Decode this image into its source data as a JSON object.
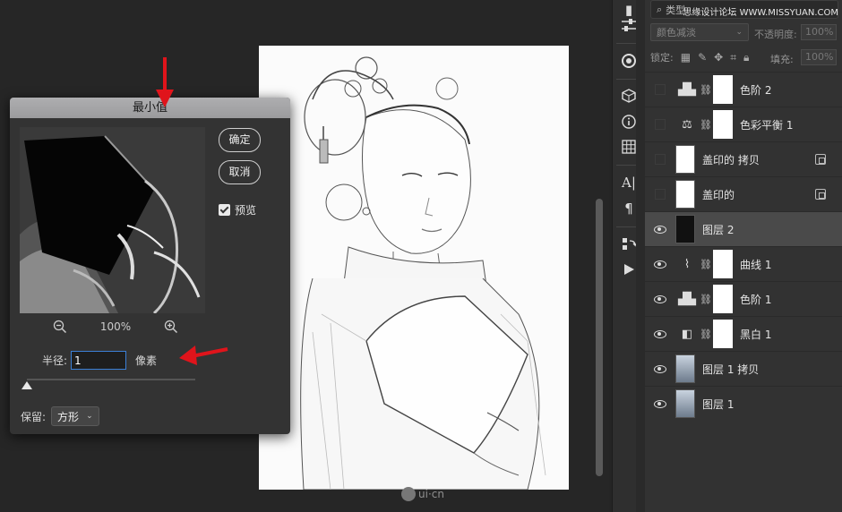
{
  "dialog": {
    "title": "最小值",
    "ok_label": "确定",
    "cancel_label": "取消",
    "preview_label": "预览",
    "preview_checked": true,
    "zoom_level": "100%",
    "radius_label": "半径:",
    "radius_value": "1",
    "radius_unit": "像素",
    "preserve_label": "保留:",
    "preserve_value": "方形"
  },
  "layers_panel": {
    "search_placeholder": "类型",
    "blend_mode": "颜色减淡",
    "opacity_label": "不透明度:",
    "opacity_value": "100%",
    "lock_label": "锁定:",
    "fill_label": "填充:",
    "fill_value": "100%",
    "layers": [
      {
        "name": "色阶 2",
        "visible": false,
        "kind": "adjustment",
        "icon": "levels-icon"
      },
      {
        "name": "色彩平衡 1",
        "visible": false,
        "kind": "adjustment",
        "icon": "balance-icon"
      },
      {
        "name": "盖印的 拷贝",
        "visible": false,
        "kind": "smart",
        "icon": ""
      },
      {
        "name": "盖印的",
        "visible": false,
        "kind": "smart",
        "icon": ""
      },
      {
        "name": "图层 2",
        "visible": true,
        "kind": "pixel-dark",
        "icon": "",
        "selected": true
      },
      {
        "name": "曲线 1",
        "visible": true,
        "kind": "adjustment",
        "icon": "curves-icon"
      },
      {
        "name": "色阶 1",
        "visible": true,
        "kind": "adjustment",
        "icon": "levels-icon"
      },
      {
        "name": "黑白 1",
        "visible": true,
        "kind": "adjustment",
        "icon": "black-white-icon"
      },
      {
        "name": "图层 1 拷贝",
        "visible": true,
        "kind": "pixel-photo",
        "icon": ""
      },
      {
        "name": "图层 1",
        "visible": true,
        "kind": "pixel-photo",
        "icon": ""
      }
    ]
  },
  "watermark_site": "思缘设计论坛 WWW.MISSYUAN.COM",
  "canvas_watermark": "ui·cn",
  "colors": {
    "arrow": "#e0141b",
    "input_focus": "#3b7fd6",
    "selected_layer": "#4a4a4a"
  }
}
